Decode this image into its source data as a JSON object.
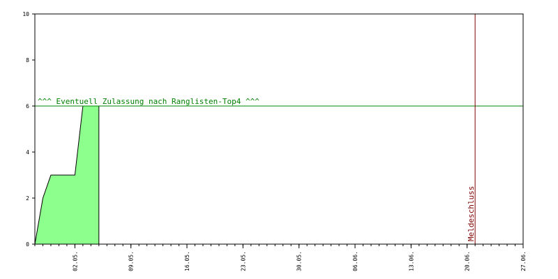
{
  "chart_data": {
    "type": "area",
    "title": "",
    "xlabel": "",
    "ylabel": "",
    "ylim": [
      0,
      10
    ],
    "y_ticks": [
      "0",
      "2",
      "4",
      "6",
      "8",
      "10"
    ],
    "y_tick_values": [
      0,
      2,
      4,
      6,
      8,
      10
    ],
    "xlim": [
      "2021-04-27",
      "2021-06-27"
    ],
    "x_ticks": [
      {
        "label": "02.05.",
        "date": "2021-05-02"
      },
      {
        "label": "09.05.",
        "date": "2021-05-09"
      },
      {
        "label": "16.05.",
        "date": "2021-05-16"
      },
      {
        "label": "23.05.",
        "date": "2021-05-23"
      },
      {
        "label": "30.05.",
        "date": "2021-05-30"
      },
      {
        "label": "06.06.",
        "date": "2021-06-06"
      },
      {
        "label": "13.06.",
        "date": "2021-06-13"
      },
      {
        "label": "20.06.",
        "date": "2021-06-20"
      },
      {
        "label": "27.06.",
        "date": "2021-06-27"
      }
    ],
    "series": [
      {
        "points": [
          {
            "date": "2021-04-27",
            "value": 0
          },
          {
            "date": "2021-04-28",
            "value": 2
          },
          {
            "date": "2021-04-29",
            "value": 3
          },
          {
            "date": "2021-05-02",
            "value": 3
          },
          {
            "date": "2021-05-03",
            "value": 6
          },
          {
            "date": "2021-05-05",
            "value": 6
          }
        ]
      }
    ],
    "threshold": {
      "value": 6,
      "label": "^^^ Eventuell Zulassung nach Ranglisten-Top4 ^^^"
    },
    "deadline": {
      "date": "2021-06-21",
      "label": "Meldeschluss"
    },
    "grid": false,
    "colors": {
      "area_fill": "#8cff8c",
      "area_line": "#000000",
      "threshold": "#008000",
      "deadline": "#800000",
      "axis": "#000000"
    }
  }
}
